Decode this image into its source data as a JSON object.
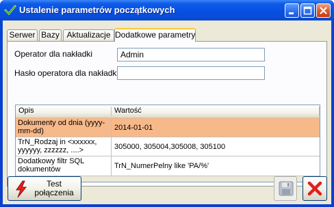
{
  "window": {
    "title": "Ustalenie parametrów początkowych"
  },
  "tabs": [
    {
      "label": "Serwer"
    },
    {
      "label": "Bazy"
    },
    {
      "label": "Aktualizacje"
    },
    {
      "label": "Dodatkowe parametry",
      "active": true
    }
  ],
  "form": {
    "operator_label": "Operator dla nakładki",
    "operator_value": "Admin",
    "password_label": "Hasło operatora dla nakładki",
    "password_value": ""
  },
  "grid": {
    "headers": [
      "Opis",
      "Wartość"
    ],
    "rows": [
      {
        "desc": "Dokumenty od dnia (yyyy-mm-dd)",
        "value": "2014-01-01",
        "selected": true
      },
      {
        "desc": "TrN_Rodzaj in <xxxxxx, yyyyyy, zzzzzz, ....>",
        "value": "305000, 305004,305008, 305100",
        "selected": false
      },
      {
        "desc": "Dodatkowy filtr SQL dokumentów",
        "value": "TrN_NumerPelny like 'PA/%'",
        "selected": false
      }
    ]
  },
  "buttons": {
    "test_line1": "Test",
    "test_line2": "połączenia"
  },
  "colors": {
    "titlebar": "#0650e2",
    "selected_row": "#f7b98a",
    "dialog_bg": "#ece9d8",
    "cancel_icon": "#e02020"
  }
}
